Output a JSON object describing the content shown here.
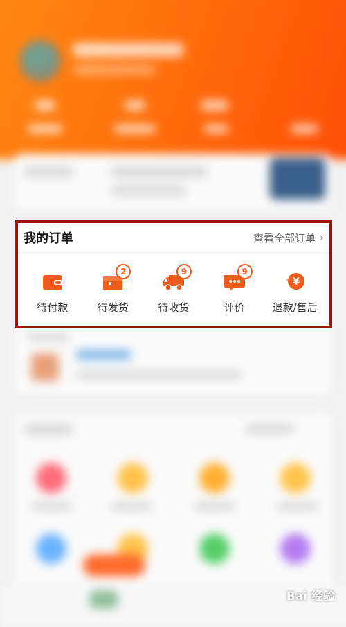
{
  "orders": {
    "title": "我的订单",
    "view_all": "查看全部订单",
    "items": [
      {
        "label": "待付款",
        "icon": "wallet-icon",
        "badge": null
      },
      {
        "label": "待发货",
        "icon": "package-icon",
        "badge": "2"
      },
      {
        "label": "待收货",
        "icon": "truck-icon",
        "badge": "9"
      },
      {
        "label": "评价",
        "icon": "comment-icon",
        "badge": "9"
      },
      {
        "label": "退款/售后",
        "icon": "refund-icon",
        "badge": null
      }
    ]
  },
  "colors": {
    "accent": "#f05a1a",
    "highlight_border": "#a3120d",
    "header_gradient_start": "#ff8a12",
    "header_gradient_end": "#ff4d06"
  },
  "watermark": "Bai 经验"
}
